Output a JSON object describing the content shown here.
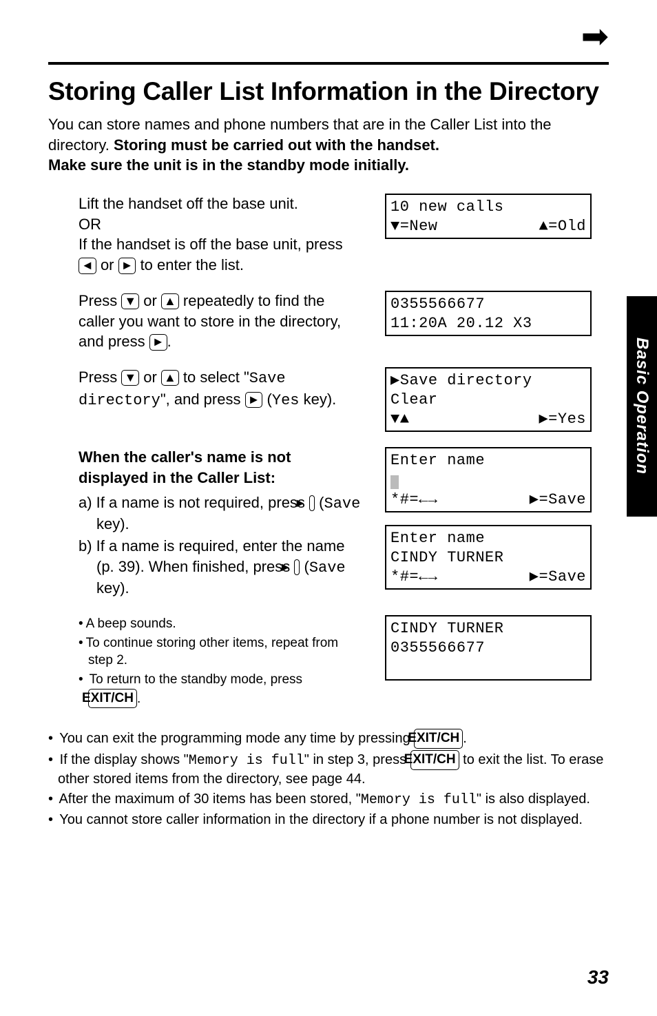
{
  "page_forward_icon": "➡",
  "title": "Storing Caller List Information in the Directory",
  "intro_plain": "You can store names and phone numbers that are in the Caller List into the directory. ",
  "intro_bold1": "Storing must be carried out with the handset.",
  "intro_bold2": "Make sure the unit is in the standby mode initially.",
  "keys": {
    "left": "◄",
    "right": "►",
    "up": "▲",
    "down": "▼",
    "exit": "EXIT/CH"
  },
  "steps": [
    {
      "text": {
        "line1": "Lift the handset off the base unit.",
        "line2": "OR",
        "line3a": "If the handset is off the base unit, press ",
        "line3b": " or ",
        "line3c": " to enter the list."
      },
      "lcd": {
        "l1": " 10 new calls",
        "l2a": "▼=New",
        "l2b": "▲=Old"
      }
    },
    {
      "text": {
        "a": "Press ",
        "b": " or ",
        "c": " repeatedly to find the caller you want to store in the directory, and press ",
        "d": "."
      },
      "lcd": {
        "l1": "0355566677",
        "l2": "11:20A 20.12 X3"
      }
    },
    {
      "text": {
        "a": "Press ",
        "b": " or ",
        "c": " to select \"",
        "mono1": "Save directory",
        "d": "\", and press ",
        "e": " (",
        "mono2": "Yes",
        "f": " key)."
      },
      "lcd": {
        "l1": "▶Save directory",
        "l2": " Clear",
        "l3a": "▼▲",
        "l3b": "▶=Yes"
      }
    },
    {
      "heading1": "When the caller's name is not",
      "heading2": "displayed in the Caller List:",
      "a_pre": "a)  If a name is not required, press ",
      "a_paren_open": " (",
      "a_mono": "Save",
      "a_paren_close": " key).",
      "b_pre": "b)  If a name is required, enter the name (p. 39). When finished, press ",
      "b_paren_open": " (",
      "b_mono": "Save",
      "b_paren_close": " key).",
      "lcd1": {
        "l1": "Enter name",
        "l3a": "*#=←→",
        "l3b": "▶=Save"
      },
      "lcd2": {
        "l1": "Enter name",
        "l2": "CINDY TURNER",
        "l3a": "*#=←→",
        "l3b": "▶=Save"
      }
    },
    {
      "bul1": "A beep sounds.",
      "bul2": "To continue storing other items, repeat from step 2.",
      "bul3a": "To return to the standby mode, press ",
      "bul3b": ".",
      "lcd": {
        "l1": "CINDY TURNER",
        "l2": "0355566677"
      }
    }
  ],
  "notes": {
    "n1a": "You can exit the programming mode any time by pressing ",
    "n1b": ".",
    "n2a": "If the display shows \"",
    "n2mono1": "Memory is full",
    "n2b": "\" in step 3, press ",
    "n2c": " to exit the list. To erase other stored items from the directory, see page 44.",
    "n3a": "After the maximum of 30 items has been stored, \"",
    "n3mono": "Memory is full",
    "n3b": "\" is also displayed.",
    "n4": "You cannot store caller information in the directory if a phone number is not displayed."
  },
  "side_tab": "Basic Operation",
  "page_number": "33"
}
